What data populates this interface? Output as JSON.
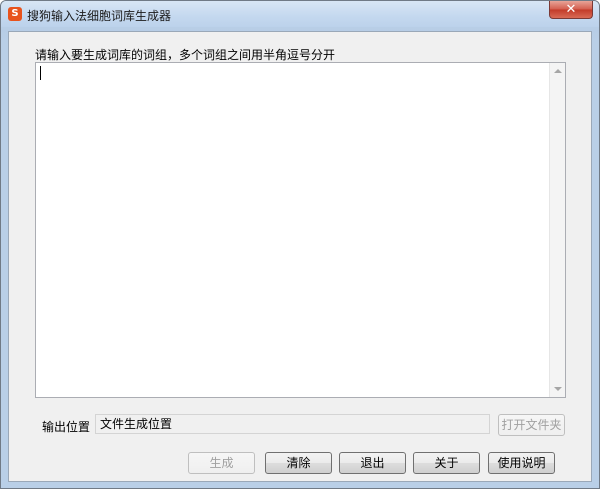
{
  "window": {
    "title": "搜狗输入法细胞词库生成器",
    "icon_glyph": "S",
    "close_glyph": "✕"
  },
  "form": {
    "prompt": "请输入要生成词库的词组，多个词组之间用半角逗号分开",
    "input_value": "",
    "output_label": "输出位置",
    "output_value": "文件生成位置"
  },
  "buttons": {
    "browse": "打开文件夹",
    "generate": "生成",
    "clear": "清除",
    "exit": "退出",
    "about": "关于",
    "help": "使用说明"
  },
  "colors": {
    "accent_close": "#c23a28",
    "icon": "#e8531d"
  }
}
